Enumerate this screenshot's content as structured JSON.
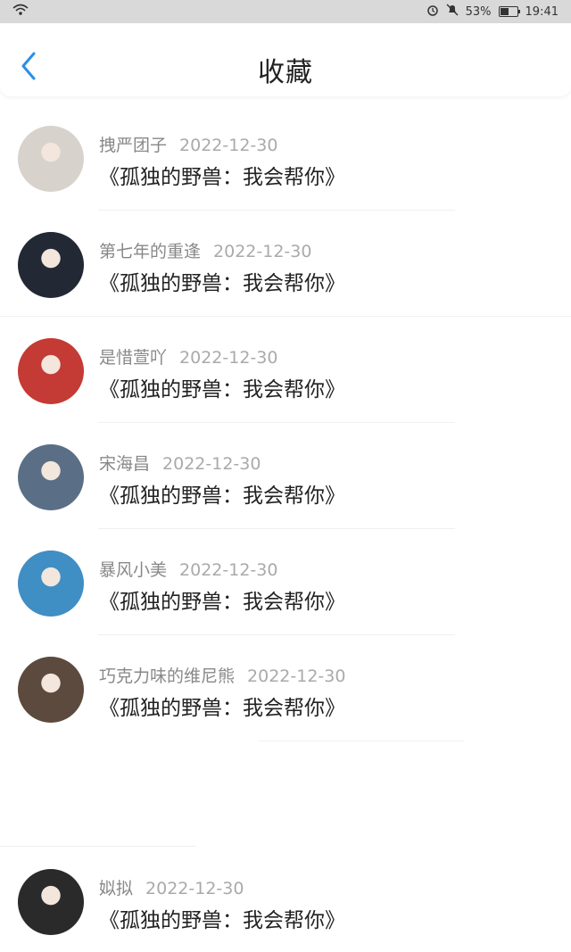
{
  "status": {
    "battery": "53%",
    "time": "19:41",
    "battery_level": 0.53
  },
  "header": {
    "title": "收藏"
  },
  "items": [
    {
      "user": "拽严团子",
      "date": "2022-12-30",
      "book": "《孤独的野兽：我会帮你》",
      "avatar_color": "#d8d2cc"
    },
    {
      "user": "第七年的重逢",
      "date": "2022-12-30",
      "book": "《孤独的野兽：我会帮你》",
      "avatar_color": "#222834"
    },
    {
      "user": "是惜萱吖",
      "date": "2022-12-30",
      "book": "《孤独的野兽：我会帮你》",
      "avatar_color": "#c43a35"
    },
    {
      "user": "宋海昌",
      "date": "2022-12-30",
      "book": "《孤独的野兽：我会帮你》",
      "avatar_color": "#5a6f86"
    },
    {
      "user": "暴风小美",
      "date": "2022-12-30",
      "book": "《孤独的野兽：我会帮你》",
      "avatar_color": "#3f8ec4"
    },
    {
      "user": "巧克力味的维尼熊",
      "date": "2022-12-30",
      "book": "《孤独的野兽：我会帮你》",
      "avatar_color": "#5b4a3d"
    },
    {
      "user": "姒拟",
      "date": "2022-12-30",
      "book": "《孤独的野兽：我会帮你》",
      "avatar_color": "#2a2a2a"
    }
  ],
  "colors": {
    "accent": "#2a8fe6",
    "text": "#222222",
    "muted": "#888888"
  }
}
